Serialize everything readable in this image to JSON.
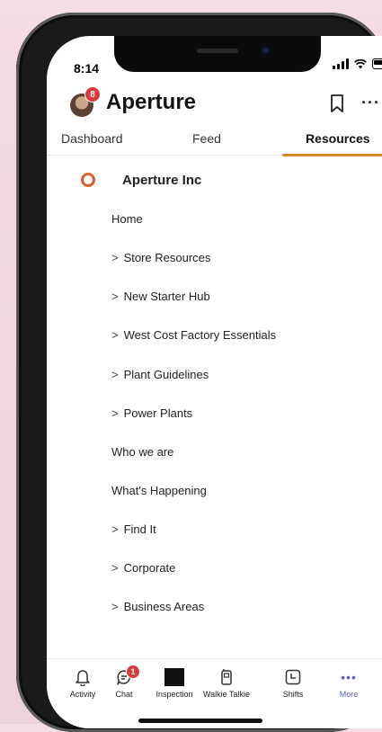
{
  "status": {
    "time": "8:14"
  },
  "header": {
    "title": "Aperture",
    "avatar_badge": "8",
    "more": "···"
  },
  "tabs": [
    {
      "label": "Dashboard",
      "active": false
    },
    {
      "label": "Feed",
      "active": false
    },
    {
      "label": "Resources",
      "active": true
    }
  ],
  "site": {
    "name": "Aperture Inc",
    "accent": "#d9622c"
  },
  "nav": [
    {
      "label": "Home",
      "expandable": false
    },
    {
      "label": "Store Resources",
      "expandable": true
    },
    {
      "label": "New Starter Hub",
      "expandable": true
    },
    {
      "label": "West Cost Factory Essentials",
      "expandable": true
    },
    {
      "label": "Plant Guidelines",
      "expandable": true
    },
    {
      "label": "Power Plants",
      "expandable": true
    },
    {
      "label": "Who we are",
      "expandable": false
    },
    {
      "label": "What's Happening",
      "expandable": false
    },
    {
      "label": "Find It",
      "expandable": true
    },
    {
      "label": "Corporate",
      "expandable": true
    },
    {
      "label": "Business Areas",
      "expandable": true
    }
  ],
  "chevron": ">",
  "bottom_tabs": [
    {
      "label": "Activity",
      "icon": "bell-icon",
      "active": false
    },
    {
      "label": "Chat",
      "icon": "chat-icon",
      "active": false,
      "badge": "1"
    },
    {
      "label": "Inspection",
      "icon": "inspection-icon",
      "active": false
    },
    {
      "label": "Walkie Talkie",
      "icon": "walkie-talkie-icon",
      "active": false
    },
    {
      "label": "Shifts",
      "icon": "shifts-icon",
      "active": false
    },
    {
      "label": "More",
      "icon": "more-icon",
      "active": true,
      "glyph": "•••"
    }
  ],
  "colors": {
    "tab_underline": "#d58a2a",
    "active_bottom": "#5b5fc7",
    "badge": "#d93b3b"
  }
}
